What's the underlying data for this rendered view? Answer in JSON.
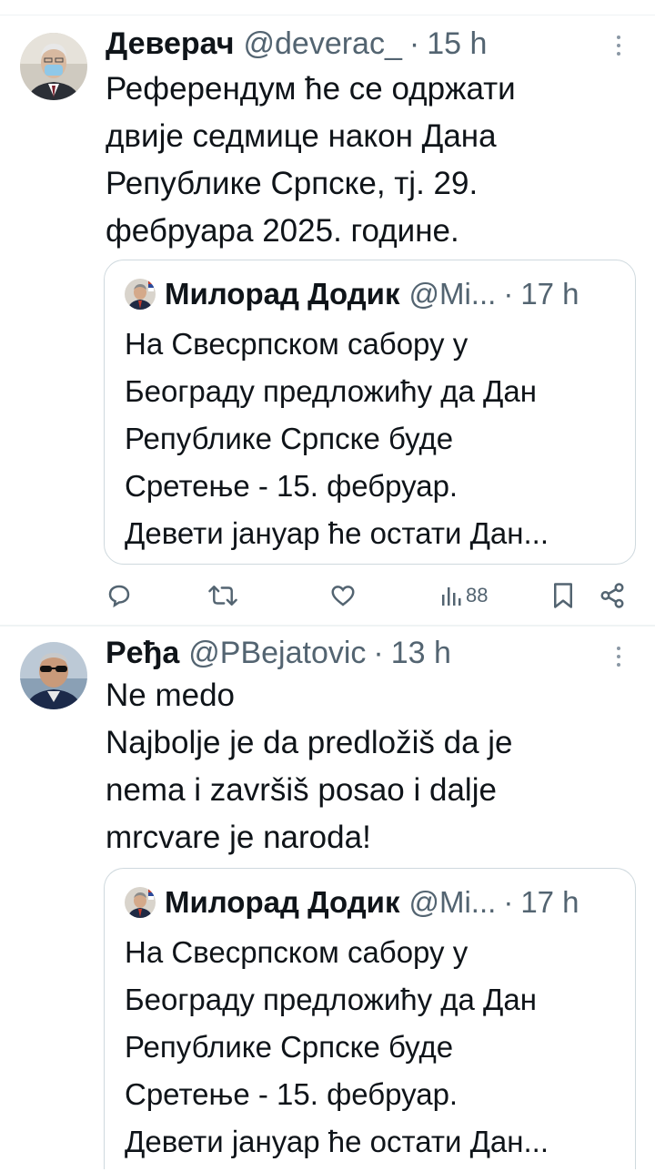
{
  "tweets": [
    {
      "display_name": "Деверач",
      "handle": "@deverac_",
      "separator": "·",
      "time": "15 h",
      "text_lines": [
        "Референдум ће се одржати",
        "двије седмице након Дана",
        "Републике Српске, тј. 29.",
        "фебруара 2025. године."
      ],
      "quote": {
        "display_name": "Милорад Додик",
        "handle": "@Mi...",
        "separator": "·",
        "time": "17 h",
        "text_lines": [
          "На Свесрпском сабору у",
          "Београду предложићу да Дан",
          "Републике Српске буде",
          "Сретење - 15. фебруар.",
          "Девети јануар ће остати Дан..."
        ]
      },
      "actions": {
        "reply_icon": "reply-icon",
        "retweet_icon": "retweet-icon",
        "like_icon": "heart-icon",
        "views_icon": "views-icon",
        "views_count": "88",
        "bookmark_icon": "bookmark-icon",
        "share_icon": "share-icon"
      }
    },
    {
      "display_name": "Peђa",
      "handle": "@PBejatovic",
      "separator": "·",
      "time": "13 h",
      "text_lines": [
        "Ne medo",
        "Najbolje je da predložiš da je",
        "nema i završiš posao i dalje",
        "mrcvare je naroda!"
      ],
      "quote": {
        "display_name": "Милорад Додик",
        "handle": "@Mi...",
        "separator": "·",
        "time": "17 h",
        "text_lines": [
          "На Свесрпском сабору у",
          "Београду предложићу да Дан",
          "Републике Српске буде",
          "Сретење - 15. фебруар.",
          "Девети јануар ће остати Дан..."
        ]
      }
    }
  ],
  "colors": {
    "text": "#0f1419",
    "muted": "#536471",
    "border": "#cfd9de",
    "divider": "#eff3f4"
  }
}
